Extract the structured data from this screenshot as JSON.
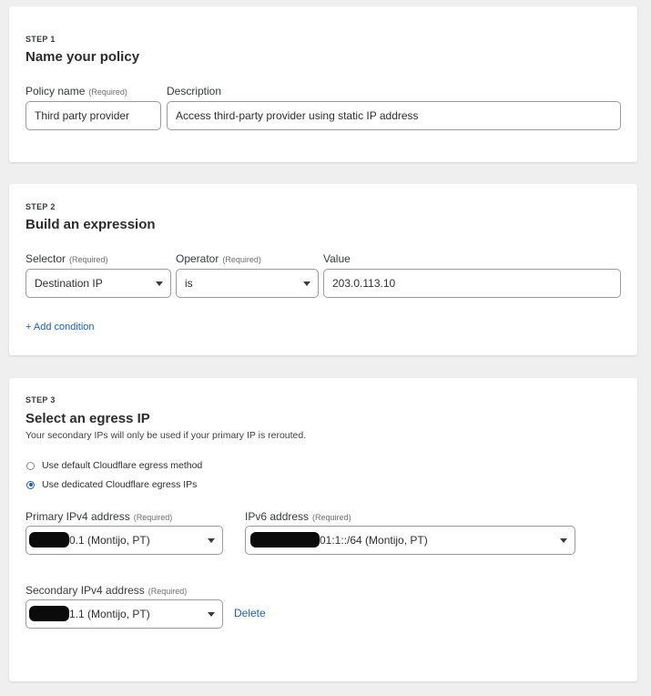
{
  "step1": {
    "step_label": "STEP 1",
    "title": "Name your policy",
    "policy_name_label": "Policy name",
    "policy_name_required": "(Required)",
    "policy_name_value": "Third party provider",
    "description_label": "Description",
    "description_value": "Access third-party provider using static IP address"
  },
  "step2": {
    "step_label": "STEP 2",
    "title": "Build an expression",
    "selector_label": "Selector",
    "selector_required": "(Required)",
    "selector_value": "Destination IP",
    "operator_label": "Operator",
    "operator_required": "(Required)",
    "operator_value": "is",
    "value_label": "Value",
    "value_value": "203.0.113.10",
    "add_condition": "+ Add condition"
  },
  "step3": {
    "step_label": "STEP 3",
    "title": "Select an egress IP",
    "help_text": "Your secondary IPs will only be used if your primary IP is rerouted.",
    "radio_default": "Use default Cloudflare egress method",
    "radio_dedicated": "Use dedicated Cloudflare egress IPs",
    "primary_label": "Primary IPv4 address",
    "primary_required": "(Required)",
    "primary_value_visible": "0.1 (Montijo, PT)",
    "ipv6_label": "IPv6 address",
    "ipv6_required": "(Required)",
    "ipv6_value_visible": "01:1::/64 (Montijo, PT)",
    "secondary_label": "Secondary IPv4 address",
    "secondary_required": "(Required)",
    "secondary_value_visible": "1.1 (Montijo, PT)",
    "delete_label": "Delete"
  },
  "colors": {
    "page_bg": "#efefef",
    "card_bg": "#ffffff",
    "link": "#1c5fb6",
    "border": "#9a9a9a"
  },
  "icons": [
    "chevron-down-icon",
    "radio-icon"
  ]
}
